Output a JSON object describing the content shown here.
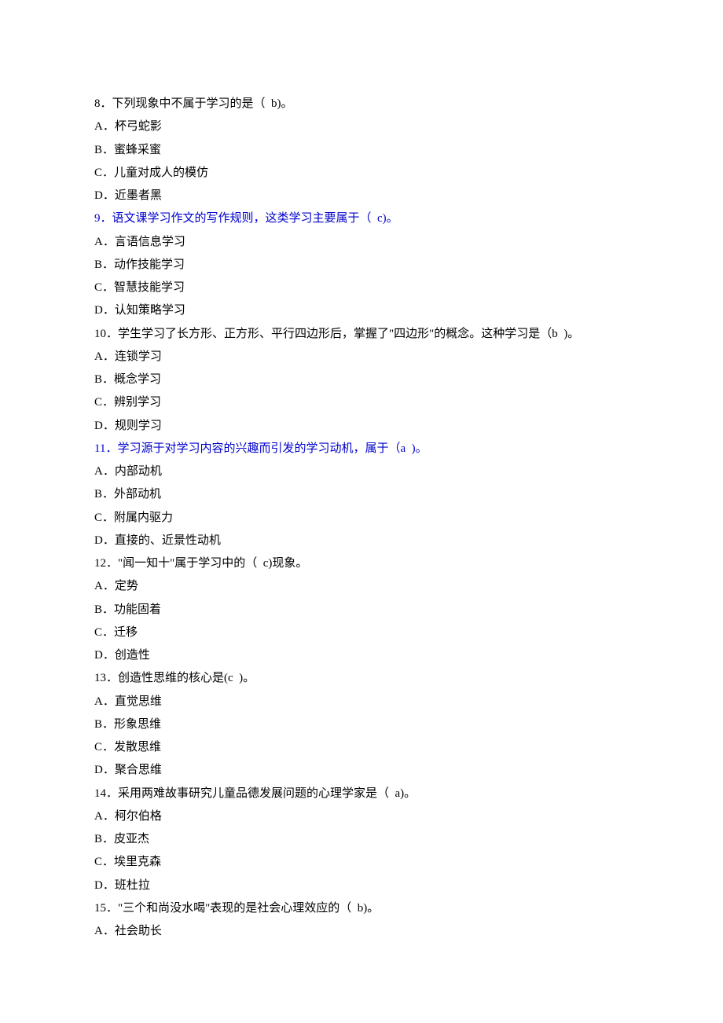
{
  "questions": [
    {
      "stem": "8．下列现象中不属于学习的是（  b)。",
      "stemClass": "black",
      "options": [
        "A．杯弓蛇影",
        "B．蜜蜂采蜜",
        "C．儿童对成人的模仿",
        "D．近墨者黑"
      ]
    },
    {
      "stem": "9．语文课学习作文的写作规则，这类学习主要属于（  c)。",
      "stemClass": "blue",
      "options": [
        "A．言语信息学习",
        "B．动作技能学习",
        "C．智慧技能学习",
        "D．认知策略学习"
      ]
    },
    {
      "stem": "10．学生学习了长方形、正方形、平行四边形后，掌握了\"四边形\"的概念。这种学习是（b  )。",
      "stemClass": "black",
      "options": [
        "A．连锁学习",
        "B．概念学习",
        "C．辨别学习",
        "D．规则学习"
      ]
    },
    {
      "stem": "11．学习源于对学习内容的兴趣而引发的学习动机，属于（a  )。",
      "stemClass": "blue",
      "options": [
        "A．内部动机",
        "B．外部动机",
        "C．附属内驱力",
        "D．直接的、近景性动机"
      ]
    },
    {
      "stem": "12．\"闻一知十\"属于学习中的（  c)现象。",
      "stemClass": "black",
      "options": [
        "A．定势",
        "B．功能固着",
        "C．迁移",
        "D．创造性"
      ]
    },
    {
      "stem": "13．创造性思维的核心是(c  )。",
      "stemClass": "black",
      "options": [
        "A．直觉思维",
        "B．形象思维",
        "C．发散思维",
        "D．聚合思维"
      ]
    },
    {
      "stem": "14．采用两难故事研究儿童品德发展问题的心理学家是（  a)。",
      "stemClass": "black",
      "options": [
        "A．柯尔伯格",
        "B．皮亚杰",
        "C．埃里克森",
        "D．班杜拉"
      ]
    },
    {
      "stem": "15．\"三个和尚没水喝\"表现的是社会心理效应的（  b)。",
      "stemClass": "black",
      "options": [
        "A．社会助长"
      ]
    }
  ]
}
